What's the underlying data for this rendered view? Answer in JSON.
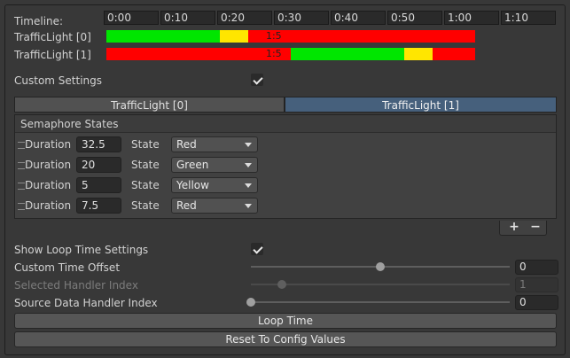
{
  "timeline": {
    "label": "Timeline:",
    "ticks": [
      "0:00",
      "0:10",
      "0:20",
      "0:30",
      "0:40",
      "0:50",
      "1:00",
      "1:10"
    ]
  },
  "tracks": [
    {
      "label": "TrafficLight [0]",
      "segments": [
        {
          "color": "#00e600",
          "start": 0,
          "end": 20
        },
        {
          "color": "#ffe600",
          "start": 20,
          "end": 25
        },
        {
          "color": "#ff0000",
          "start": 25,
          "end": 65
        }
      ],
      "marker": {
        "text": "1:5",
        "at": 29.5
      }
    },
    {
      "label": "TrafficLight [1]",
      "segments": [
        {
          "color": "#ff0000",
          "start": 0,
          "end": 32.5
        },
        {
          "color": "#00e600",
          "start": 32.5,
          "end": 52.5
        },
        {
          "color": "#ffe600",
          "start": 52.5,
          "end": 57.5
        },
        {
          "color": "#ff0000",
          "start": 57.5,
          "end": 65
        }
      ],
      "marker": {
        "text": "1:5",
        "at": 29.5
      }
    }
  ],
  "custom_settings": {
    "label": "Custom Settings",
    "checked": true
  },
  "tabs": [
    {
      "label": "TrafficLight [0]",
      "active": false
    },
    {
      "label": "TrafficLight [1]",
      "active": true
    }
  ],
  "semaphore": {
    "title": "Semaphore States",
    "duration_label": "Duration",
    "state_label": "State",
    "rows": [
      {
        "duration": "32.5",
        "state": "Red"
      },
      {
        "duration": "20",
        "state": "Green"
      },
      {
        "duration": "5",
        "state": "Yellow"
      },
      {
        "duration": "7.5",
        "state": "Red"
      }
    ],
    "add_label": "+",
    "remove_label": "−"
  },
  "loop_settings": {
    "show_label": "Show Loop Time Settings",
    "show_checked": true,
    "offset": {
      "label": "Custom Time Offset",
      "value": "0",
      "fraction": 0.5,
      "enabled": true
    },
    "selected": {
      "label": "Selected Handler Index",
      "value": "1",
      "fraction": 0.12,
      "enabled": false
    },
    "source": {
      "label": "Source Data Handler Index",
      "value": "0",
      "fraction": 0.0,
      "enabled": true
    }
  },
  "buttons": {
    "loop_time": "Loop Time",
    "reset": "Reset To Config Values"
  }
}
